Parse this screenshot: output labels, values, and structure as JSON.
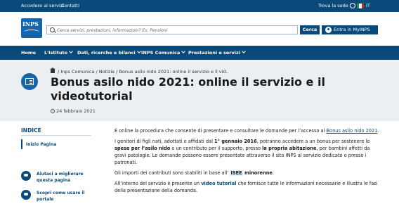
{
  "topbar": {
    "link1": "Accedere ai servizi",
    "link2": "Contatti",
    "site_label": "Trova la sede",
    "lang": "IT"
  },
  "header": {
    "logo_text": "INPS",
    "search_placeholder": "Cerca servizi, prestazioni, informazioni? Es. Pensioni",
    "search_button": "Cerca",
    "login_button": "Entra in MyINPS"
  },
  "nav": {
    "items": [
      "Home",
      "L'Istituto",
      "Dati, ricerche e bilanci",
      "INPS Comunica",
      "Prestazioni e servizi"
    ]
  },
  "breadcrumb": "/ Inps Comunica / Notizie / Bonus asilo nido 2021: online il servizio e il vid..",
  "title": "Bonus asilo nido 2021: online il servizio e il videotutorial",
  "date": "24 febbraio 2021",
  "sidebar": {
    "index_title": "INDICE",
    "index_link": "Inizio Pagina",
    "help1": "Aiutaci a migliorare questa pagina",
    "help2": "Scopri come usare il portale"
  },
  "content": {
    "p1a": "È online la procedura che consente di presentare e consultare le domande per l’accesso al ",
    "p1link": "Bonus asilo nido 2021",
    "p1b": ".",
    "p2a": "I genitori di figli nati, adottati o affidati dal ",
    "p2b": "1° gennaio 2016",
    "p2c": ", potranno accedere a un bonus per sostenere le ",
    "p2d": "spese per l’asilo nido",
    "p2e": " o un contributo per il supporto, presso ",
    "p2f": "la propria abitazione",
    "p2g": ", per bambini affetti da gravi patologie. Le domande possono essere presentate attraverso il sito INPS al servizio dedicato o presso i patronati.",
    "p3a": "Gli importi dei contributi sono stabiliti in base all’ ",
    "p3b": "ISEE",
    "p3c": " minorenne",
    "p3d": ".",
    "p4a": "All’interno del servizio è presente un ",
    "p4b": "video tutorial",
    "p4c": " che fornisce tutte le informazioni necessarie e illustra le fasi della presentazione della domanda."
  },
  "colors": {
    "primary": "#0a4a7a",
    "logo": "#1565a8",
    "hero_bg": "#ebeff2"
  }
}
